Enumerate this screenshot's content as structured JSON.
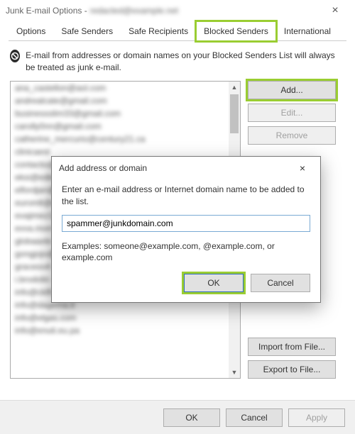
{
  "window": {
    "title": "Junk E-mail Options -",
    "email_blurred": "redacted@example.net",
    "close_glyph": "×"
  },
  "tabs": {
    "items": [
      "Options",
      "Safe Senders",
      "Safe Recipients",
      "Blocked Senders",
      "International"
    ],
    "active_index": 3
  },
  "blocked": {
    "description": "E-mail from addresses or domain names on your Blocked Senders List will always be treated as junk e-mail.",
    "list_items": [
      "ana_castellon@aol.com",
      "andrealcate@gmail.com",
      "businessslim33@gmail.com",
      "carolly0nn@gmail.com",
      "catherine_mercurio@century21.ca",
      "clinicaest",
      "contacto@",
      "eksi@edire",
      "elfordjan@",
      "euromlt@e",
      "evajimez1",
      "evva.morr",
      "globaaxle",
      "gongjojo@",
      "graceoo4",
      "i.brodolin",
      "info@cklfi.cz",
      "info@dagema.it",
      "info@elgas.com",
      "info@enuti.eu.pa"
    ]
  },
  "side_buttons": {
    "add": "Add...",
    "edit": "Edit...",
    "remove": "Remove",
    "import": "Import from File...",
    "export": "Export to File..."
  },
  "footer": {
    "ok": "OK",
    "cancel": "Cancel",
    "apply": "Apply"
  },
  "dialog": {
    "title": "Add address or domain",
    "close_glyph": "×",
    "prompt": "Enter an e-mail address or Internet domain name to be added to the list.",
    "input_value": "spammer@junkdomain.com",
    "examples": "Examples: someone@example.com, @example.com, or example.com",
    "ok": "OK",
    "cancel": "Cancel"
  },
  "highlight_color": "#9ACD32"
}
